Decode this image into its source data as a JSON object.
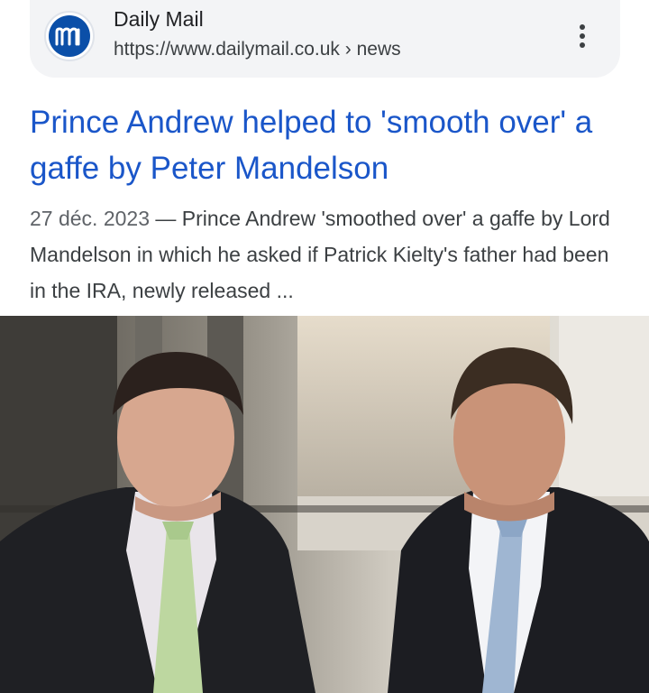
{
  "source": {
    "name": "Daily Mail",
    "url": "https://www.dailymail.co.uk",
    "breadcrumb": "› news",
    "logo_icon": "daily-mail-logo"
  },
  "result": {
    "title": "Prince Andrew helped to 'smooth over' a gaffe by Peter Mandelson",
    "date": "27 déc. 2023",
    "separator": "—",
    "snippet": "Prince Andrew 'smoothed over' a gaffe by Lord Mandelson in which he asked if Patrick Kielty's father had been in the IRA, newly released ..."
  },
  "colors": {
    "title_link": "#1a56c9",
    "card_background": "#f3f4f6",
    "logo_blue": "#0b4fa8"
  }
}
